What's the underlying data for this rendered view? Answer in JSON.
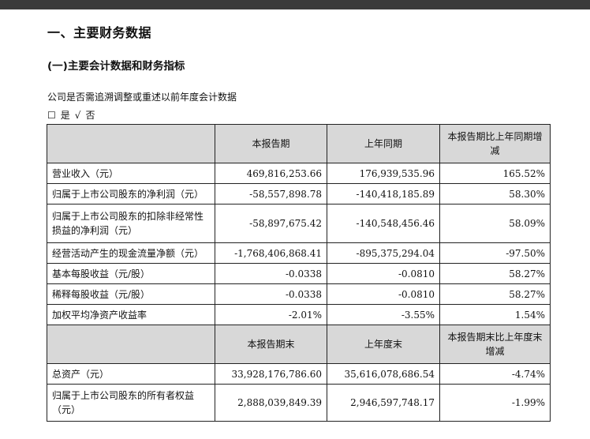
{
  "section_title": "一、主要财务数据",
  "subsection_title": "(一)主要会计数据和财务指标",
  "restate_question": "公司是否需追溯调整或重述以前年度会计数据",
  "choice": {
    "box": "☐",
    "yes": "是",
    "check": "√",
    "no": "否"
  },
  "table": {
    "header1": {
      "current": "本报告期",
      "prior": "上年同期",
      "change": "本报告期比上年同期增减"
    },
    "rows1": [
      {
        "label": "营业收入（元）",
        "current": "469,816,253.66",
        "prior": "176,939,535.96",
        "change": "165.52%"
      },
      {
        "label": "归属于上市公司股东的净利润（元）",
        "current": "-58,557,898.78",
        "prior": "-140,418,185.89",
        "change": "58.30%"
      },
      {
        "label": "归属于上市公司股东的扣除非经常性损益的净利润（元）",
        "current": "-58,897,675.42",
        "prior": "-140,548,456.46",
        "change": "58.09%"
      },
      {
        "label": "经营活动产生的现金流量净额（元）",
        "current": "-1,768,406,868.41",
        "prior": "-895,375,294.04",
        "change": "-97.50%"
      },
      {
        "label": "基本每股收益（元/股）",
        "current": "-0.0338",
        "prior": "-0.0810",
        "change": "58.27%"
      },
      {
        "label": "稀释每股收益（元/股）",
        "current": "-0.0338",
        "prior": "-0.0810",
        "change": "58.27%"
      },
      {
        "label": "加权平均净资产收益率",
        "current": "-2.01%",
        "prior": "-3.55%",
        "change": "1.54%"
      }
    ],
    "header2": {
      "current": "本报告期末",
      "prior": "上年度末",
      "change": "本报告期末比上年度末增减"
    },
    "rows2": [
      {
        "label": "总资产（元）",
        "current": "33,928,176,786.60",
        "prior": "35,616,078,686.54",
        "change": "-4.74%"
      },
      {
        "label": "归属于上市公司股东的所有者权益（元）",
        "current": "2,888,039,849.39",
        "prior": "2,946,597,748.17",
        "change": "-1.99%"
      }
    ]
  }
}
